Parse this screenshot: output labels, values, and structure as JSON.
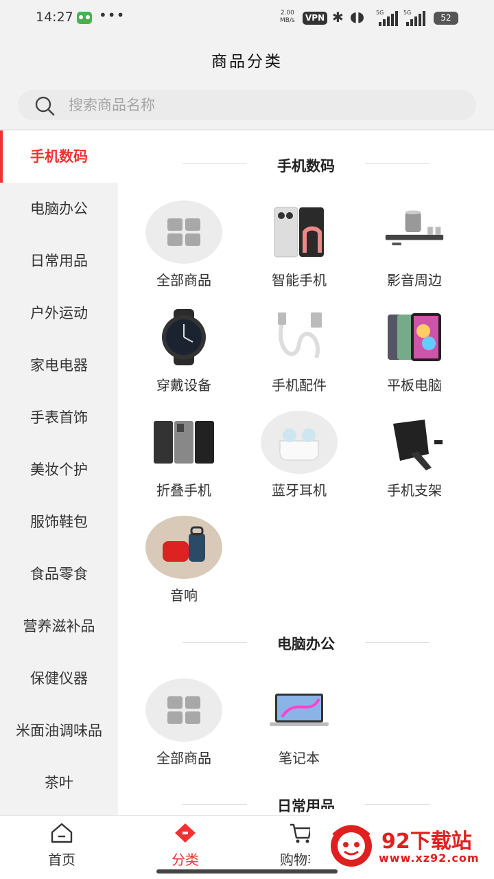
{
  "status_bar": {
    "time": "14:27",
    "dots": "•••",
    "speed_value": "2.00",
    "speed_unit": "MB/s",
    "vpn": "VPN",
    "network_1": "5G",
    "network_2": "5G",
    "battery": "52"
  },
  "header": {
    "title": "商品分类"
  },
  "search": {
    "placeholder": "搜索商品名称"
  },
  "sidebar": {
    "items": [
      "手机数码",
      "电脑办公",
      "日常用品",
      "户外运动",
      "家电电器",
      "手表首饰",
      "美妆个护",
      "服饰鞋包",
      "食品零食",
      "营养滋补品",
      "保健仪器",
      "米面油调味品",
      "茶叶"
    ],
    "active_index": 0
  },
  "sections": [
    {
      "title": "手机数码",
      "items": [
        {
          "label": "全部商品",
          "icon": "grid-icon"
        },
        {
          "label": "智能手机",
          "icon": "smartphone-icon"
        },
        {
          "label": "影音周边",
          "icon": "speaker-set-icon"
        },
        {
          "label": "穿戴设备",
          "icon": "smartwatch-icon"
        },
        {
          "label": "手机配件",
          "icon": "usb-cable-icon"
        },
        {
          "label": "平板电脑",
          "icon": "tablet-icon"
        },
        {
          "label": "折叠手机",
          "icon": "foldable-phone-icon"
        },
        {
          "label": "蓝牙耳机",
          "icon": "earbuds-icon"
        },
        {
          "label": "手机支架",
          "icon": "phone-holder-icon"
        },
        {
          "label": "音响",
          "icon": "bluetooth-speaker-icon"
        }
      ]
    },
    {
      "title": "电脑办公",
      "items": [
        {
          "label": "全部商品",
          "icon": "grid-icon"
        },
        {
          "label": "笔记本",
          "icon": "laptop-icon"
        }
      ]
    },
    {
      "title": "日常用品",
      "items": []
    }
  ],
  "tabbar": {
    "items": [
      {
        "label": "首页",
        "icon": "home-icon"
      },
      {
        "label": "分类",
        "icon": "category-icon"
      },
      {
        "label": "购物车",
        "icon": "cart-icon"
      }
    ],
    "active_index": 1
  },
  "watermark": {
    "name": "92下载站",
    "url": "www.xz92.com"
  },
  "colors": {
    "accent": "#ee3333",
    "sidebar_bg": "#f2f2f2",
    "content_bg": "#ffffff"
  }
}
